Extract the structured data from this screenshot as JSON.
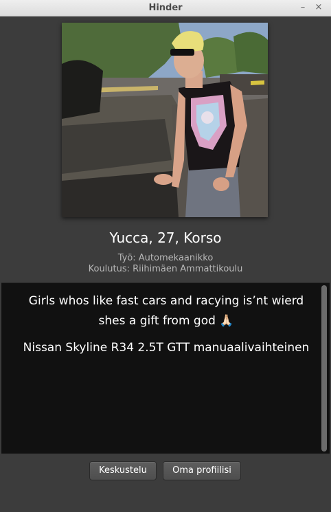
{
  "window": {
    "title": "Hinder",
    "minimize_glyph": "–",
    "close_glyph": "×"
  },
  "profile": {
    "name_line": "Yucca, 27, Korso",
    "job_line": "Työ: Automekaanikko",
    "education_line": "Koulutus: Riihimäen Ammattikoulu",
    "bio": "Girls whos like fast cars and racying is’nt wierd shes a gift from god 🙏🏻",
    "car": "Nissan Skyline R34 2.5T GTT manuaalivaihteinen"
  },
  "actions": {
    "chat_label": "Keskustelu",
    "own_profile_label": "Oma profiilisi"
  },
  "colors": {
    "background": "#3c3c3c",
    "bio_panel": "#111111",
    "text": "#ffffff",
    "muted_text": "#b8b8b8",
    "button": "#555555"
  }
}
